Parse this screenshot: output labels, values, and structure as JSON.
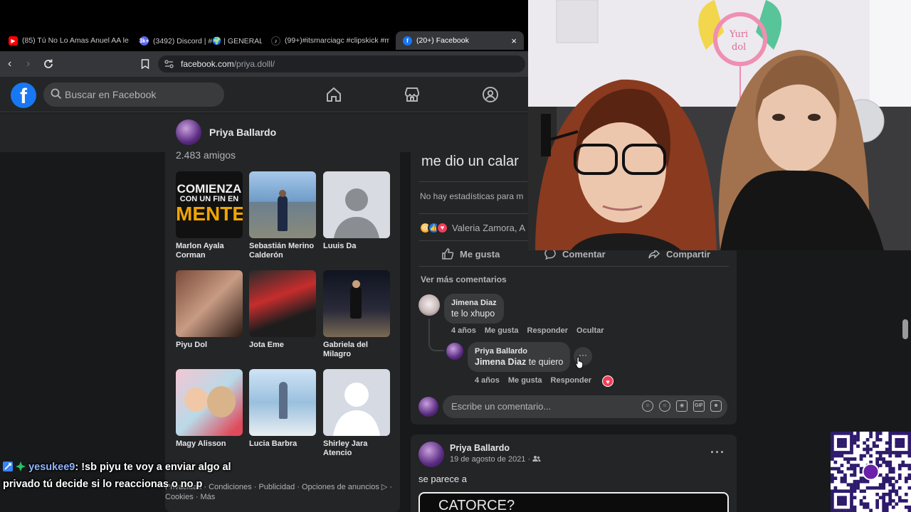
{
  "browser": {
    "tabs": [
      {
        "title": "(85) Tú No Lo Amas Anuel AA le",
        "icon_color": "#ff0000"
      },
      {
        "title": "(3492) Discord | #🌍 | GENERAL | P",
        "icon_color": "#5865f2",
        "badge": "3k+"
      },
      {
        "title": "(99+)#itsmarciagc #clipskick #m",
        "icon_color": "#000000"
      },
      {
        "title": "(20+) Facebook",
        "icon_color": "#1877f2",
        "close": "×"
      }
    ],
    "url_host": "facebook.com",
    "url_path": "/priya.dolll/"
  },
  "fb": {
    "search_placeholder": "Buscar en Facebook",
    "profile_name": "Priya Ballardo",
    "friends_count": "2.483 amigos",
    "friends": [
      {
        "name": "Marlon Ayala Corman",
        "poster": [
          "COMIENZA",
          "CON UN FIN EN",
          "MENTE"
        ]
      },
      {
        "name": "Sebastián Merino Calderón"
      },
      {
        "name": "Luuis Da"
      },
      {
        "name": "Piyu Dol"
      },
      {
        "name": "Jota Eme"
      },
      {
        "name": "Gabriela del Milagro"
      },
      {
        "name": "Magy Alisson"
      },
      {
        "name": "Lucia Barbra"
      },
      {
        "name": "Shirley Jara Atencio"
      }
    ],
    "footer_line1": "Privacidad · Condiciones · Publicidad · Opciones de anuncios ▷ ·",
    "footer_line2": "Cookies · Más",
    "post": {
      "title": "me dio un calar",
      "no_stats": "No hay estadísticas para m",
      "reactors": "Valeria Zamora, A",
      "like": "Me gusta",
      "comment": "Comentar",
      "share": "Compartir",
      "more_comments": "Ver más comentarios",
      "comment1": {
        "author": "Jimena Diaz",
        "text": "te lo xhupo",
        "time": "4 años",
        "like": "Me gusta",
        "reply": "Responder",
        "hide": "Ocultar"
      },
      "comment2": {
        "author": "Priya Ballardo",
        "mention": "Jimena Diaz",
        "text": " te quiero",
        "time": "4 años",
        "like": "Me gusta",
        "reply": "Responder"
      },
      "write_placeholder": "Escribe un comentario..."
    },
    "post2": {
      "author": "Priya Ballardo",
      "date": "19 de agosto de 2021 · ",
      "text": "se parece a",
      "media_text": "CATORCE?"
    }
  },
  "chat": {
    "user": "yesukee9",
    "message": ": !sb piyu te voy a enviar algo al privado tú decide si lo reaccionas o no p"
  },
  "webcam": {
    "sign_text_1": "Yuri",
    "sign_text_2": "dol"
  },
  "colors": {
    "fb_blue": "#1877f2",
    "bg": "#18191a",
    "card": "#242526",
    "chat_user": "#8fb4ff"
  }
}
